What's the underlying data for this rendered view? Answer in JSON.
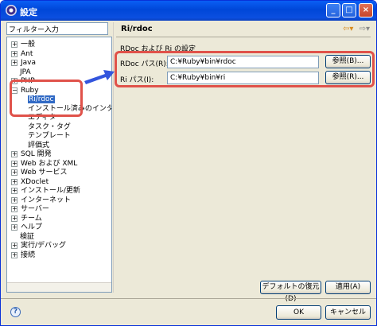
{
  "window": {
    "title": "設定"
  },
  "filter": {
    "placeholder": "フィルター入力"
  },
  "tree": [
    {
      "label": "一般",
      "twisty": "+",
      "indent": 0
    },
    {
      "label": "Ant",
      "twisty": "+",
      "indent": 0
    },
    {
      "label": "Java",
      "twisty": "+",
      "indent": 0
    },
    {
      "label": "JPA",
      "twisty": "",
      "indent": 1
    },
    {
      "label": "PHP",
      "twisty": "+",
      "indent": 0
    },
    {
      "label": "Ruby",
      "twisty": "−",
      "indent": 0
    },
    {
      "label": "Ri/rdoc",
      "twisty": "",
      "indent": 2,
      "selected": true
    },
    {
      "label": "インストール済みのインタープ",
      "twisty": "",
      "indent": 2
    },
    {
      "label": "エディター",
      "twisty": "",
      "indent": 2
    },
    {
      "label": "タスク・タグ",
      "twisty": "",
      "indent": 2
    },
    {
      "label": "テンプレート",
      "twisty": "",
      "indent": 2
    },
    {
      "label": "評価式",
      "twisty": "",
      "indent": 2
    },
    {
      "label": "SQL 開発",
      "twisty": "+",
      "indent": 0
    },
    {
      "label": "Web および XML",
      "twisty": "+",
      "indent": 0
    },
    {
      "label": "Web サービス",
      "twisty": "+",
      "indent": 0
    },
    {
      "label": "XDoclet",
      "twisty": "+",
      "indent": 0
    },
    {
      "label": "インストール/更新",
      "twisty": "+",
      "indent": 0
    },
    {
      "label": "インターネット",
      "twisty": "+",
      "indent": 0
    },
    {
      "label": "サーバー",
      "twisty": "+",
      "indent": 0
    },
    {
      "label": "チーム",
      "twisty": "+",
      "indent": 0
    },
    {
      "label": "ヘルプ",
      "twisty": "+",
      "indent": 0
    },
    {
      "label": "検証",
      "twisty": "",
      "indent": 1
    },
    {
      "label": "実行/デバッグ",
      "twisty": "+",
      "indent": 0
    },
    {
      "label": "接続",
      "twisty": "+",
      "indent": 0
    }
  ],
  "page": {
    "title": "Ri/rdoc",
    "section_label": "RDoc および Ri の設定",
    "rdoc_label": "RDoc パス(R):",
    "rdoc_value": "C:¥Ruby¥bin¥rdoc",
    "ri_label": "Ri パス(I):",
    "ri_value": "C:¥Ruby¥bin¥ri",
    "browse_label": "参照(B)...",
    "browse_label_2": "参照(R)...",
    "restore_defaults": "デフォルトの復元(D)",
    "apply": "適用(A)"
  },
  "footer": {
    "help_glyph": "?",
    "ok": "OK",
    "cancel": "キャンセル"
  },
  "colors": {
    "highlight": "#e0524a",
    "arrow": "#3355dd",
    "selection": "#316ac5"
  },
  "icons": {
    "back": "back-arrow-icon",
    "forward": "forward-arrow-icon",
    "help": "help-icon"
  }
}
